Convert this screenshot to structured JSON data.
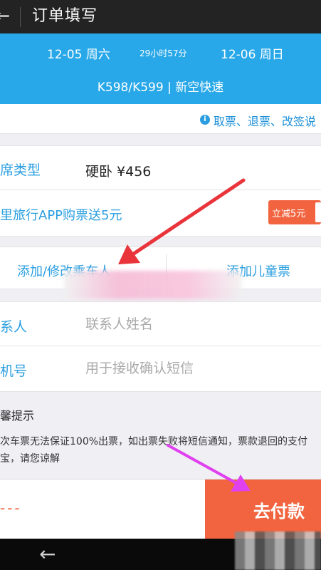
{
  "header": {
    "back_icon": "back-arrow-icon",
    "back_glyph": "←",
    "title": "订单填写"
  },
  "train": {
    "departure": "12-05 周六",
    "duration": "29小时57分",
    "arrival": "12-06 周日",
    "number_type": "K598/K599 | 新空快速"
  },
  "notice": {
    "icon": "info-icon",
    "icon_glyph": "i",
    "text": "取票、退票、改签说"
  },
  "seat": {
    "label": "席类型",
    "value": "硬卧 ¥456"
  },
  "promo": {
    "label": "里旅行APP购票送5元",
    "badge": "立减5元"
  },
  "passenger": {
    "add_label": "添加/修改乘车人",
    "child_label": "添加儿童票"
  },
  "contact": {
    "label": "系人",
    "placeholder": "联系人姓名"
  },
  "phone": {
    "label": "机号",
    "placeholder": "用于接收确认短信"
  },
  "tips": {
    "heading": "馨提示",
    "body": "次车票无法保证100%出票，如出票失败将短信通知，票款退回的支付宝，请您谅解"
  },
  "footer": {
    "total": "---",
    "pay_label": "去付款"
  },
  "navbar": {
    "back_icon": "nav-back-icon",
    "back_glyph": "←"
  },
  "colors": {
    "accent": "#28a8e8",
    "link": "#2a9ee0",
    "pay": "#f2643f",
    "annotation_red": "#e8343a",
    "annotation_magenta": "#e040f0"
  }
}
